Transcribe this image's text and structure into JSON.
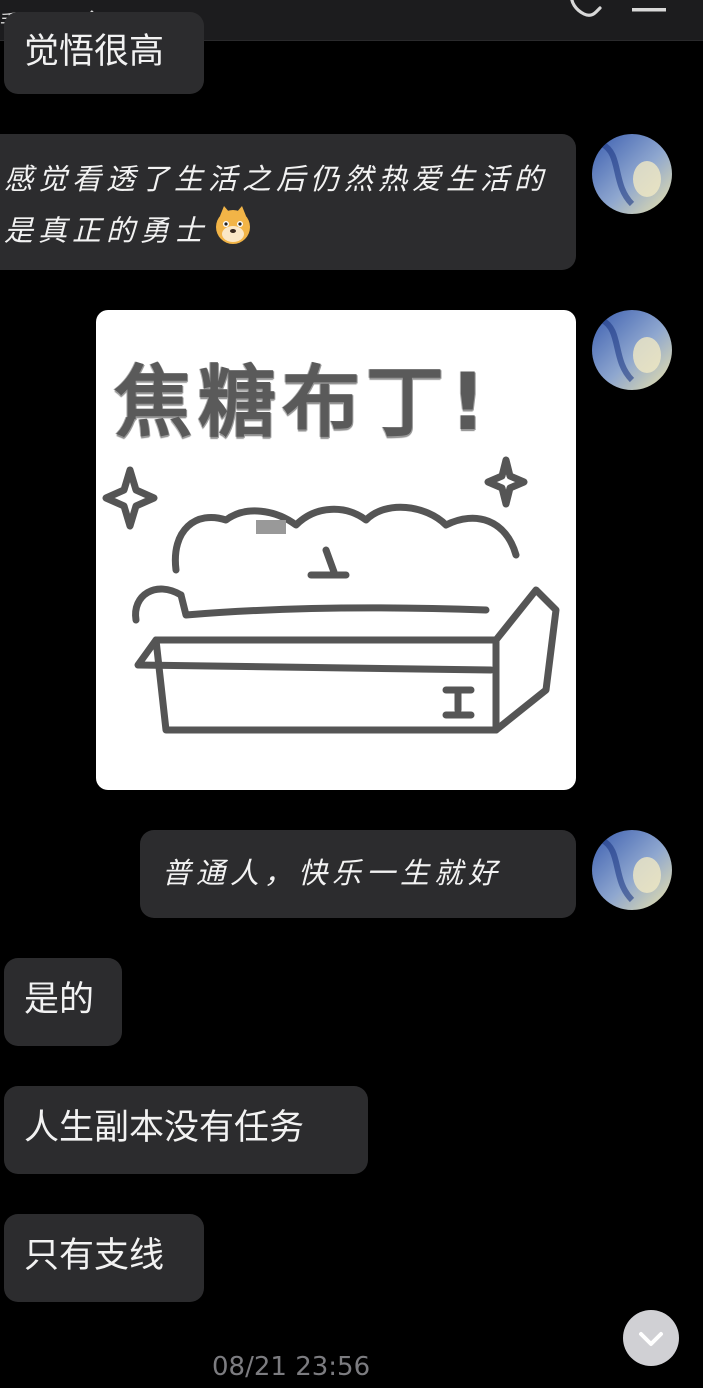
{
  "header": {
    "status": "手机在线",
    "icons": [
      "chevron-right-icon",
      "phone-icon",
      "menu-icon"
    ]
  },
  "messages": [
    {
      "side": "left",
      "text": "觉悟很高"
    },
    {
      "side": "right",
      "text": "感觉看透了生活之后仍然热爱生活的是真正的勇士",
      "emoji": "dog-face-icon"
    },
    {
      "side": "right",
      "type": "sticker",
      "sticker_text": "焦糖布丁!"
    },
    {
      "side": "right",
      "text": "普通人，快乐一生就好"
    },
    {
      "side": "left",
      "text": "是的"
    },
    {
      "side": "left",
      "text": "人生副本没有任务"
    },
    {
      "side": "left",
      "text": "只有支线"
    }
  ],
  "timestamp": "08/21 23:56",
  "colors": {
    "background": "#000000",
    "bubble": "#2c2c2e",
    "text": "#f2f2f2",
    "timestamp": "#7c7c80"
  }
}
